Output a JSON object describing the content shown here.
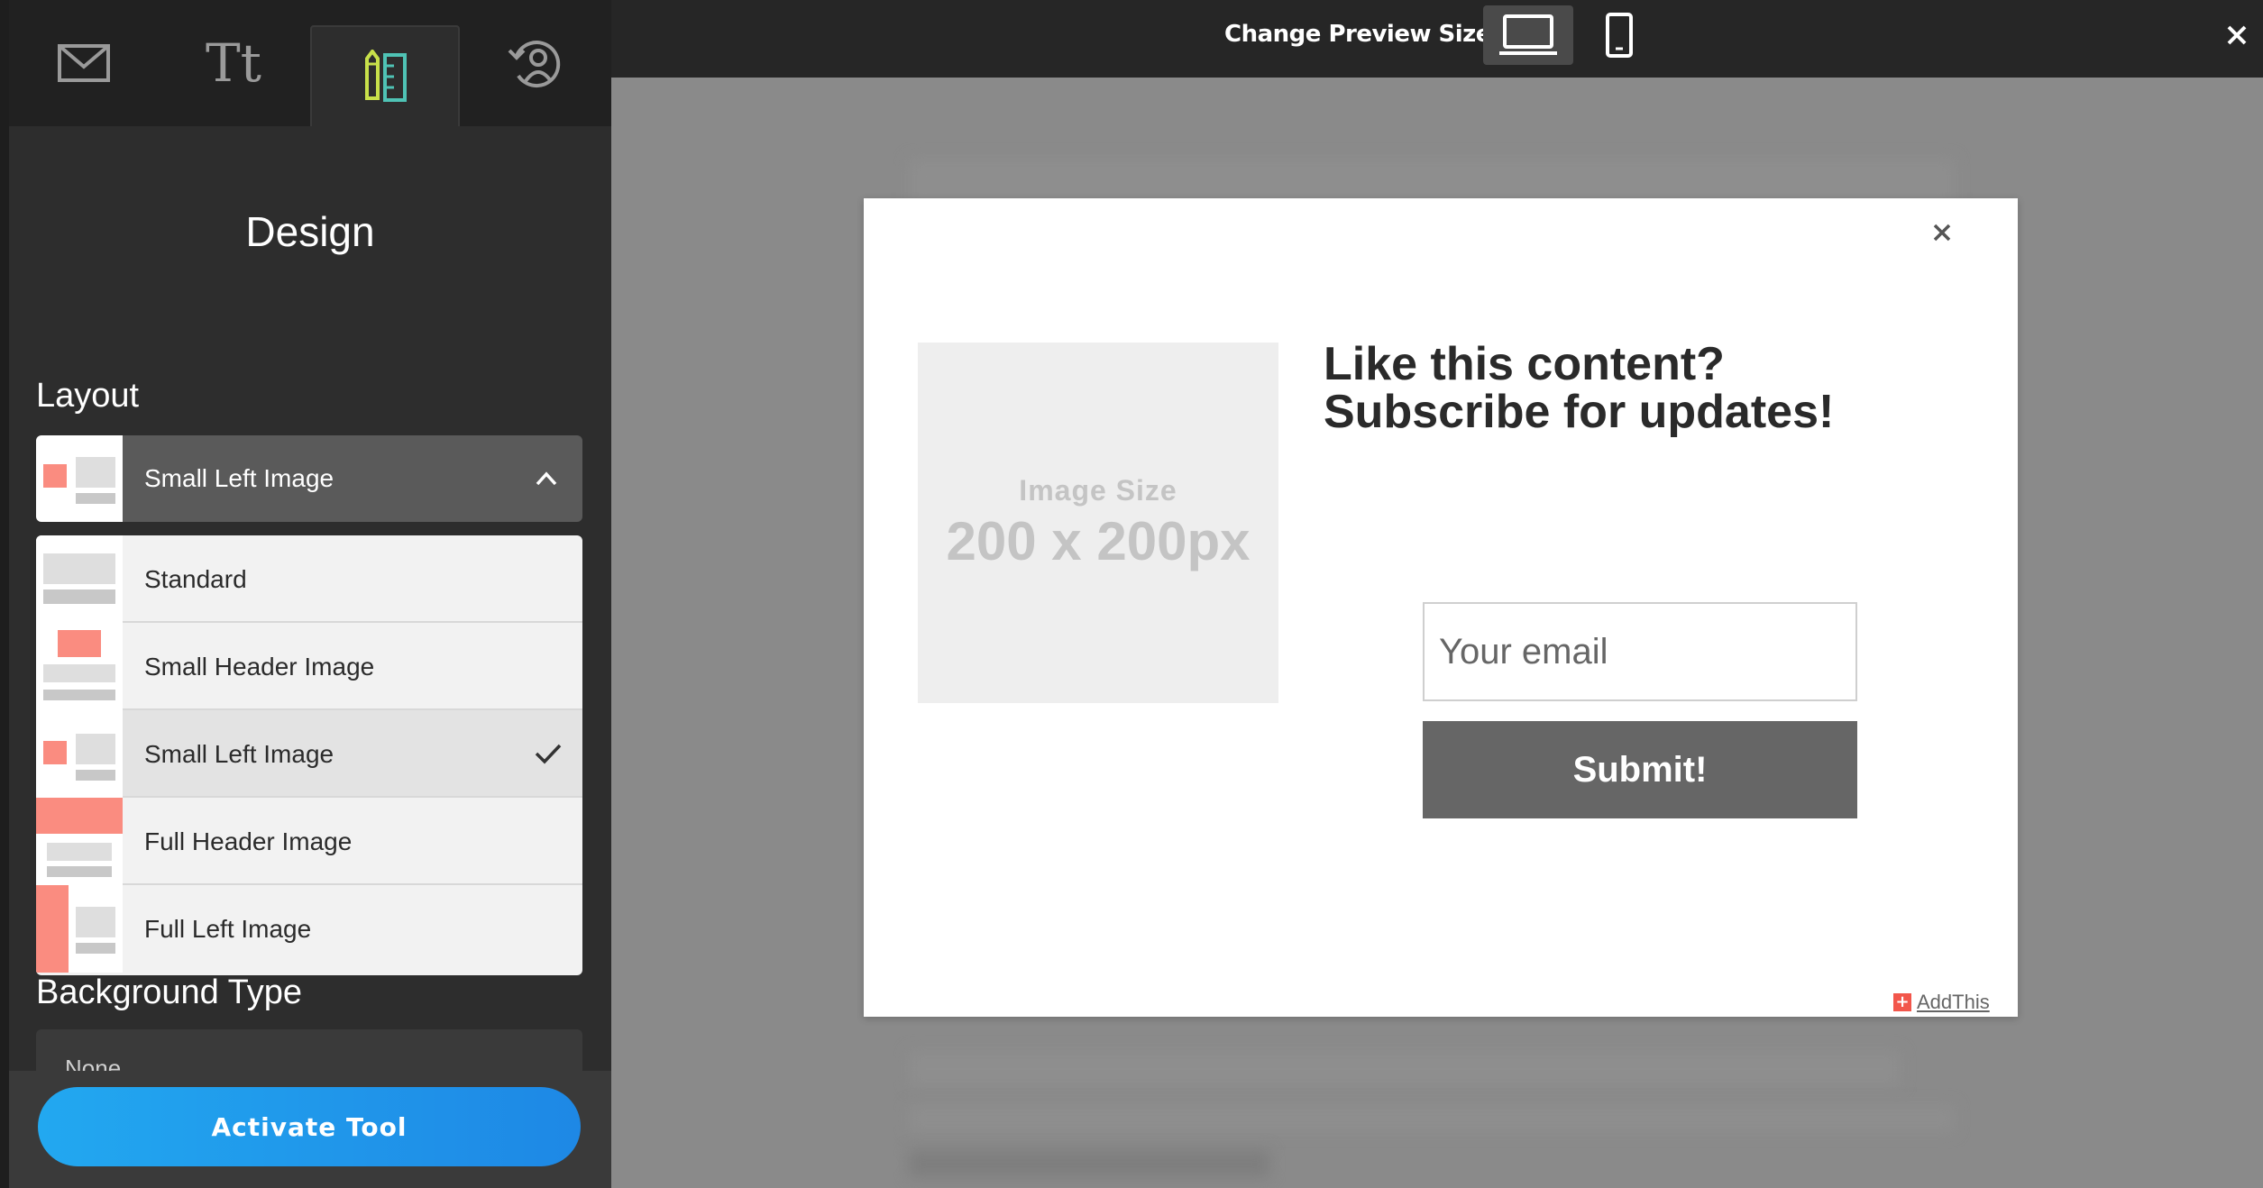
{
  "topbar": {
    "preview_label": "Change Preview Size:",
    "desktop_icon": "laptop-icon",
    "mobile_icon": "phone-icon",
    "close_icon": "close-icon"
  },
  "sidebar": {
    "tabs": [
      {
        "name": "email",
        "icon": "envelope-icon"
      },
      {
        "name": "text",
        "icon": "text-icon",
        "glyph": "Tt"
      },
      {
        "name": "design",
        "icon": "pencil-ruler-icon",
        "active": true
      },
      {
        "name": "targeting",
        "icon": "user-refresh-icon"
      }
    ],
    "section_title": "Design",
    "layout": {
      "label": "Layout",
      "selected": "Small Left Image",
      "options": [
        {
          "label": "Standard"
        },
        {
          "label": "Small Header Image"
        },
        {
          "label": "Small Left Image",
          "selected": true
        },
        {
          "label": "Full Header Image"
        },
        {
          "label": "Full Left Image"
        }
      ]
    },
    "background_type": {
      "label": "Background Type",
      "value": "None"
    },
    "activate_button": "Activate Tool"
  },
  "modal": {
    "close": "×",
    "image_placeholder": {
      "line1": "Image Size",
      "line2": "200 x 200px"
    },
    "headline": [
      "Like this content?",
      "Subscribe for updates!"
    ],
    "email_placeholder": "Your email",
    "submit_label": "Submit!",
    "brand": "AddThis"
  },
  "colors": {
    "accent_blue": "#1e88e5",
    "thumb_salmon": "#fa8c80",
    "thumb_gray": "#c8c8c8",
    "active_tab_icon": "#c8e04a"
  }
}
